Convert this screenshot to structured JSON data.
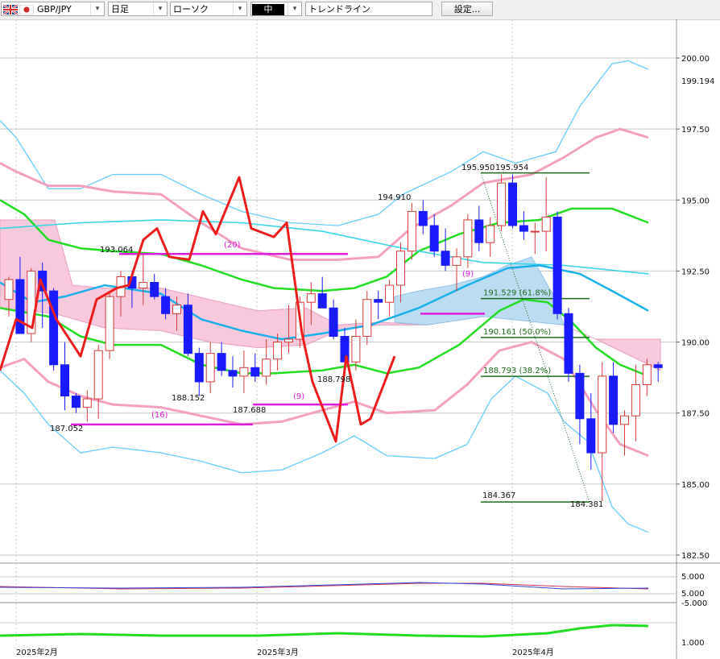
{
  "toolbar": {
    "symbol": "GBP/JPY",
    "timeframe": "日足",
    "chart_style": "ローソク",
    "line_width": "中",
    "tool": "トレンドライン",
    "settings_label": "設定..."
  },
  "icons": {
    "flag_uk": "uk-flag-icon",
    "flag_jp": "japan-flag-icon",
    "dropdown": "chevron-down-icon"
  },
  "colors": {
    "bull_candle": "#d63a3a",
    "bear_candle": "#1a1aff",
    "ichimoku_cloud": "#f8c8dc",
    "ichimoku_cloud_alt": "#bcdcf2",
    "kijun": "#37d4e8",
    "bollinger_outer": "#66ccff",
    "bollinger_inner": "#f4a0c0",
    "ma": "#22dd22",
    "trend": "#ee1c1c",
    "fib": "#1c6b1c",
    "marker_line": "#e01ee0",
    "grid": "#c8c8c8"
  },
  "chart_data": {
    "type": "candlestick",
    "instrument": "GBP/JPY",
    "timeframe": "日足",
    "price_axis_ticks": [
      "200.00",
      "197.50",
      "195.00",
      "192.50",
      "190.00",
      "187.50",
      "185.00",
      "182.50"
    ],
    "price_axis_tick_values": [
      200.0,
      197.5,
      195.0,
      192.5,
      190.0,
      187.5,
      185.0,
      182.5
    ],
    "last_price_label": "199.194",
    "ylim": [
      181.5,
      201.5
    ],
    "time_axis_labels": [
      "2025年2月",
      "2025年3月",
      "2025年4月"
    ],
    "oscillator_ticks": [
      "5.000",
      "5.000",
      "-5.000"
    ],
    "oscillator_ticks_extra": [
      "1.000"
    ],
    "price_annotations": [
      "193.064",
      "188.152",
      "187.052",
      "187.688",
      "188.798",
      "194.910",
      "195.950",
      "195.954",
      "184.367",
      "184.381"
    ],
    "count_labels": [
      "(20)",
      "(16)",
      "(9)",
      "(9)"
    ],
    "fibonacci_levels": [
      {
        "label": "191.529 (61.8%)",
        "price": 191.529
      },
      {
        "label": "190.161 (50.0%)",
        "price": 190.161
      },
      {
        "label": "188.793 (38.2%)",
        "price": 188.793
      }
    ],
    "fib_high": {
      "label": "195.954",
      "price": 195.954
    },
    "fib_low": {
      "label": "184.367",
      "price": 184.367
    },
    "candles": [
      [
        191.5,
        192.3,
        190.9,
        192.2
      ],
      [
        192.2,
        193.0,
        190.4,
        190.3
      ],
      [
        190.3,
        192.6,
        190.0,
        192.5
      ],
      [
        192.5,
        192.8,
        190.5,
        191.8
      ],
      [
        191.8,
        191.9,
        189.0,
        189.2
      ],
      [
        189.2,
        190.0,
        187.6,
        188.1
      ],
      [
        188.1,
        188.2,
        187.5,
        187.7
      ],
      [
        187.7,
        188.3,
        187.2,
        188.0
      ],
      [
        188.0,
        189.9,
        187.3,
        189.7
      ],
      [
        189.7,
        191.8,
        189.4,
        191.6
      ],
      [
        191.6,
        192.5,
        190.9,
        192.3
      ],
      [
        192.3,
        192.5,
        191.2,
        191.9
      ],
      [
        191.9,
        193.1,
        191.3,
        192.1
      ],
      [
        192.1,
        192.4,
        191.5,
        191.6
      ],
      [
        191.6,
        191.9,
        190.8,
        191.0
      ],
      [
        191.0,
        191.6,
        190.4,
        191.3
      ],
      [
        191.3,
        191.7,
        189.5,
        189.6
      ],
      [
        189.6,
        189.8,
        188.1,
        188.6
      ],
      [
        188.6,
        190.0,
        188.2,
        189.6
      ],
      [
        189.6,
        190.0,
        188.8,
        189.0
      ],
      [
        189.0,
        189.5,
        188.4,
        188.8
      ],
      [
        188.8,
        189.7,
        188.2,
        189.1
      ],
      [
        189.1,
        189.6,
        188.6,
        188.8
      ],
      [
        188.8,
        190.1,
        188.5,
        189.4
      ],
      [
        189.4,
        190.3,
        189.0,
        190.0
      ],
      [
        190.0,
        191.3,
        189.6,
        190.1
      ],
      [
        190.1,
        191.6,
        189.8,
        191.4
      ],
      [
        191.4,
        192.1,
        190.6,
        191.7
      ],
      [
        191.7,
        192.3,
        191.2,
        191.2
      ],
      [
        191.2,
        191.5,
        190.1,
        190.2
      ],
      [
        190.2,
        190.5,
        189.2,
        189.3
      ],
      [
        189.3,
        190.8,
        189.0,
        190.2
      ],
      [
        190.2,
        191.8,
        189.9,
        191.5
      ],
      [
        191.5,
        191.8,
        190.8,
        191.4
      ],
      [
        191.4,
        192.2,
        190.9,
        192.0
      ],
      [
        192.0,
        193.5,
        191.4,
        193.2
      ],
      [
        193.2,
        194.9,
        192.9,
        194.6
      ],
      [
        194.6,
        195.0,
        193.8,
        194.1
      ],
      [
        194.1,
        194.5,
        193.0,
        193.2
      ],
      [
        193.2,
        194.0,
        192.5,
        192.7
      ],
      [
        192.7,
        193.3,
        191.8,
        193.0
      ],
      [
        193.0,
        194.5,
        192.6,
        194.3
      ],
      [
        194.3,
        194.8,
        193.2,
        193.5
      ],
      [
        193.5,
        194.4,
        193.0,
        194.1
      ],
      [
        194.1,
        195.9,
        193.9,
        195.6
      ],
      [
        195.6,
        195.9,
        194.0,
        194.1
      ],
      [
        194.1,
        194.6,
        193.6,
        193.9
      ],
      [
        193.9,
        194.2,
        193.1,
        193.9
      ],
      [
        193.9,
        195.8,
        193.2,
        194.4
      ],
      [
        194.4,
        194.6,
        190.8,
        191.0
      ],
      [
        191.0,
        191.2,
        188.6,
        188.9
      ],
      [
        188.9,
        189.2,
        186.4,
        187.3
      ],
      [
        187.3,
        188.2,
        185.5,
        186.1
      ],
      [
        186.1,
        189.3,
        184.4,
        188.8
      ],
      [
        188.8,
        189.3,
        186.8,
        187.1
      ],
      [
        187.1,
        187.6,
        186.0,
        187.4
      ],
      [
        187.4,
        189.2,
        186.5,
        188.5
      ],
      [
        188.5,
        189.4,
        188.1,
        189.2
      ],
      [
        189.2,
        189.3,
        188.6,
        189.1
      ]
    ]
  }
}
